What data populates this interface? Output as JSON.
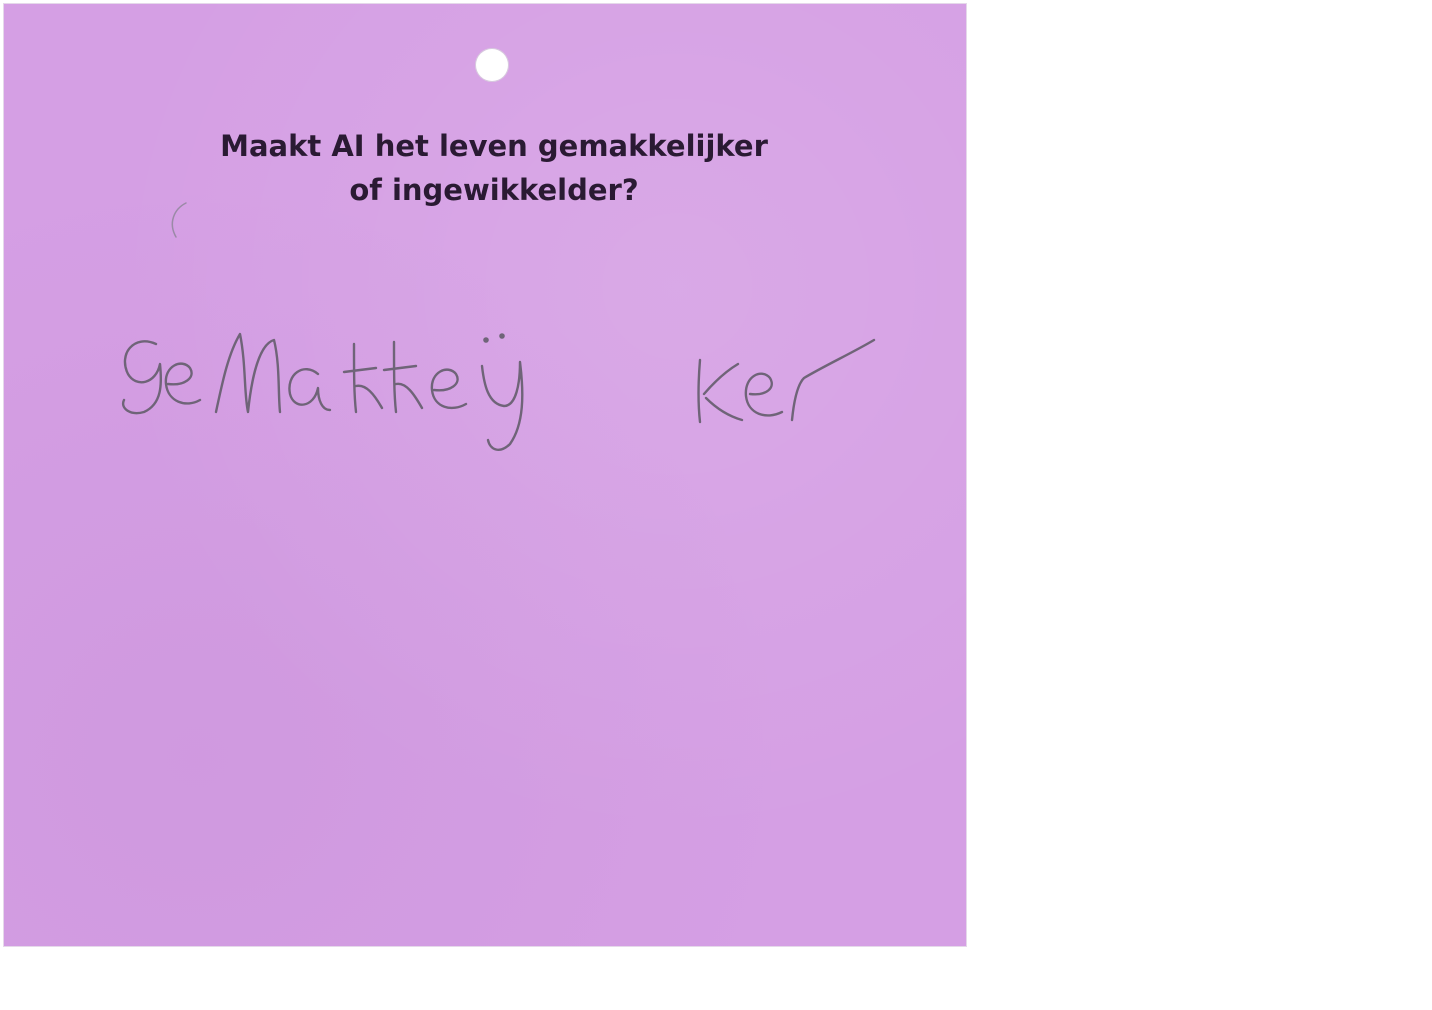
{
  "card": {
    "background_color": "#d59fe4",
    "question_lines": [
      "Maakt AI het leven gemakkelijker",
      "of ingewikkelder?"
    ],
    "handwritten_answer": "gemakkeijker",
    "ink_color": "#6f6478"
  }
}
